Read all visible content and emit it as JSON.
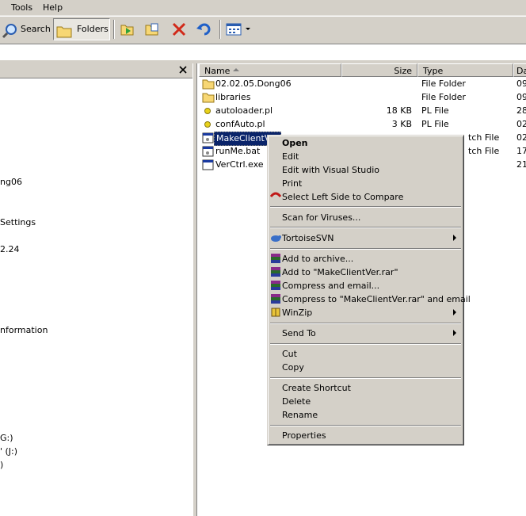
{
  "menubar": {
    "tools": "Tools",
    "help": "Help"
  },
  "toolbar": {
    "search": "Search",
    "folders": "Folders"
  },
  "folder_pane": {
    "items": [
      "ng06",
      "Settings",
      "2.24",
      "nformation",
      "G:)",
      "' (J:)",
      ")"
    ]
  },
  "list": {
    "headers": {
      "name": "Name",
      "size": "Size",
      "type": "Type",
      "date": "Da"
    },
    "rows": [
      {
        "name": "02.02.05.Dong06",
        "size": "",
        "type": "File Folder",
        "date": "09"
      },
      {
        "name": "libraries",
        "size": "",
        "type": "File Folder",
        "date": "09"
      },
      {
        "name": "autoloader.pl",
        "size": "18 KB",
        "type": "PL File",
        "date": "28"
      },
      {
        "name": "confAuto.pl",
        "size": "3 KB",
        "type": "PL File",
        "date": "02"
      },
      {
        "name": "MakeClientVer",
        "size": "",
        "type": "tch File",
        "date": "02"
      },
      {
        "name": "runMe.bat",
        "size": "",
        "type": "tch File",
        "date": "17"
      },
      {
        "name": "VerCtrl.exe",
        "size": "",
        "type": "",
        "date": "21"
      }
    ]
  },
  "context_menu": {
    "open": "Open",
    "edit": "Edit",
    "edit_vs": "Edit with Visual Studio",
    "print": "Print",
    "select_left": "Select Left Side to Compare",
    "scan": "Scan for Viruses...",
    "tortoise": "TortoiseSVN",
    "add_archive": "Add to archive...",
    "add_rar": "Add to \"MakeClientVer.rar\"",
    "compress_email": "Compress and email...",
    "compress_rar_email": "Compress to \"MakeClientVer.rar\" and email",
    "winzip": "WinZip",
    "send_to": "Send To",
    "cut": "Cut",
    "copy": "Copy",
    "create_shortcut": "Create Shortcut",
    "delete": "Delete",
    "rename": "Rename",
    "properties": "Properties"
  }
}
